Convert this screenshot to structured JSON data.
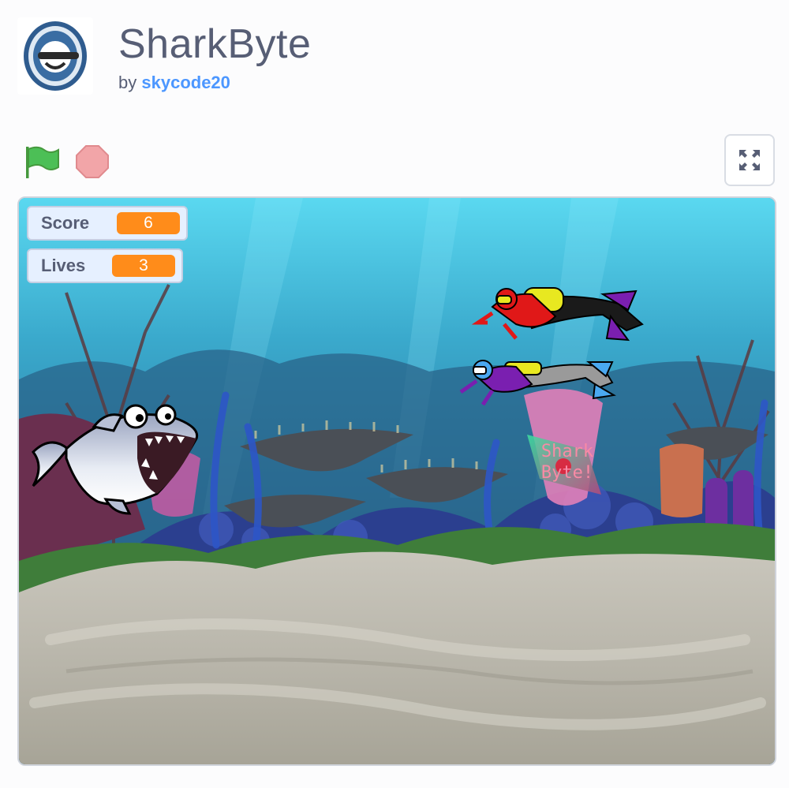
{
  "project": {
    "title": "SharkByte",
    "by_label": "by",
    "author": "skycode20"
  },
  "controls": {
    "green_flag": "green-flag-icon",
    "stop": "stop-icon",
    "fullscreen": "fullscreen-icon"
  },
  "monitors": {
    "score_label": "Score",
    "score_value": "6",
    "lives_label": "Lives",
    "lives_value": "3"
  },
  "stage": {
    "powerup_line1": "Shark",
    "powerup_line2": "Byte!"
  },
  "colors": {
    "monitor_value": "#ff8c1a",
    "author_link": "#4c97ff",
    "flag": "#4cbf56",
    "stop": "#f2a5a8"
  }
}
